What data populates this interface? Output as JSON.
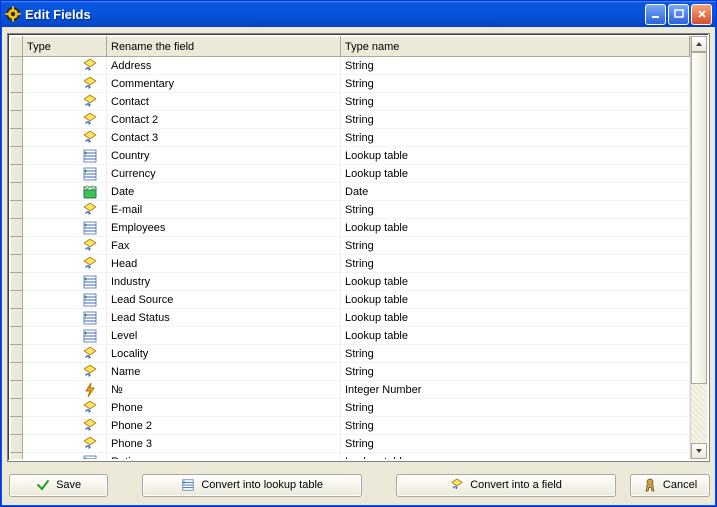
{
  "window": {
    "title": "Edit Fields"
  },
  "columns": {
    "type": "Type",
    "rename": "Rename the field",
    "typename": "Type name"
  },
  "rows": [
    {
      "icon": "field",
      "name": "Address",
      "type": "String"
    },
    {
      "icon": "field",
      "name": "Commentary",
      "type": "String"
    },
    {
      "icon": "field",
      "name": "Contact",
      "type": "String"
    },
    {
      "icon": "field",
      "name": "Contact 2",
      "type": "String"
    },
    {
      "icon": "field",
      "name": "Contact 3",
      "type": "String"
    },
    {
      "icon": "lookup",
      "name": "Country",
      "type": "Lookup table"
    },
    {
      "icon": "lookup",
      "name": "Currency",
      "type": "Lookup table"
    },
    {
      "icon": "date",
      "name": "Date",
      "type": "Date"
    },
    {
      "icon": "field",
      "name": "E-mail",
      "type": "String"
    },
    {
      "icon": "lookup",
      "name": "Employees",
      "type": "Lookup table"
    },
    {
      "icon": "field",
      "name": "Fax",
      "type": "String"
    },
    {
      "icon": "field",
      "name": "Head",
      "type": "String"
    },
    {
      "icon": "lookup",
      "name": "Industry",
      "type": "Lookup table"
    },
    {
      "icon": "lookup",
      "name": "Lead Source",
      "type": "Lookup table"
    },
    {
      "icon": "lookup",
      "name": "Lead Status",
      "type": "Lookup table"
    },
    {
      "icon": "lookup",
      "name": "Level",
      "type": "Lookup table"
    },
    {
      "icon": "field",
      "name": "Locality",
      "type": "String"
    },
    {
      "icon": "field",
      "name": "Name",
      "type": "String"
    },
    {
      "icon": "number",
      "name": "№",
      "type": "Integer Number"
    },
    {
      "icon": "field",
      "name": "Phone",
      "type": "String"
    },
    {
      "icon": "field",
      "name": "Phone 2",
      "type": "String"
    },
    {
      "icon": "field",
      "name": "Phone 3",
      "type": "String"
    },
    {
      "icon": "lookup",
      "name": "Rating",
      "type": "Lookup table"
    }
  ],
  "buttons": {
    "save": "Save",
    "convert_lookup": "Convert into lookup table",
    "convert_field": "Convert into a field",
    "cancel": "Cancel"
  }
}
